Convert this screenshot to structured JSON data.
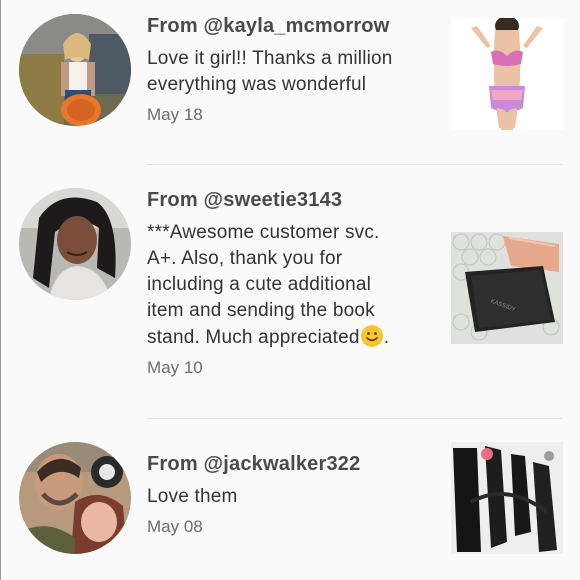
{
  "reviews": [
    {
      "from": "From @kayla_mcmorrow",
      "message": "Love it girl!! Thanks a million\neverything was wonderful",
      "date": "May 18",
      "avatar_icon": "user-photo-icon",
      "thumb_icon": "bikini-photo-icon"
    },
    {
      "from": "From @sweetie3143",
      "message": "***Awesome customer svc.\nA+. Also, thank you for\nincluding a cute additional\nitem and sending the book\nstand. Much appreciated",
      "message_suffix": ".",
      "date": "May 10",
      "avatar_icon": "user-photo-icon",
      "thumb_icon": "box-photo-icon"
    },
    {
      "from": "From @jackwalker322",
      "message": "Love them",
      "date": "May 08",
      "avatar_icon": "user-photo-icon",
      "thumb_icon": "clothing-photo-icon"
    }
  ],
  "colors": {
    "background": "#fbfafb",
    "text": "#333333",
    "muted": "#6b6b6b",
    "divider": "#e4e4e4"
  }
}
